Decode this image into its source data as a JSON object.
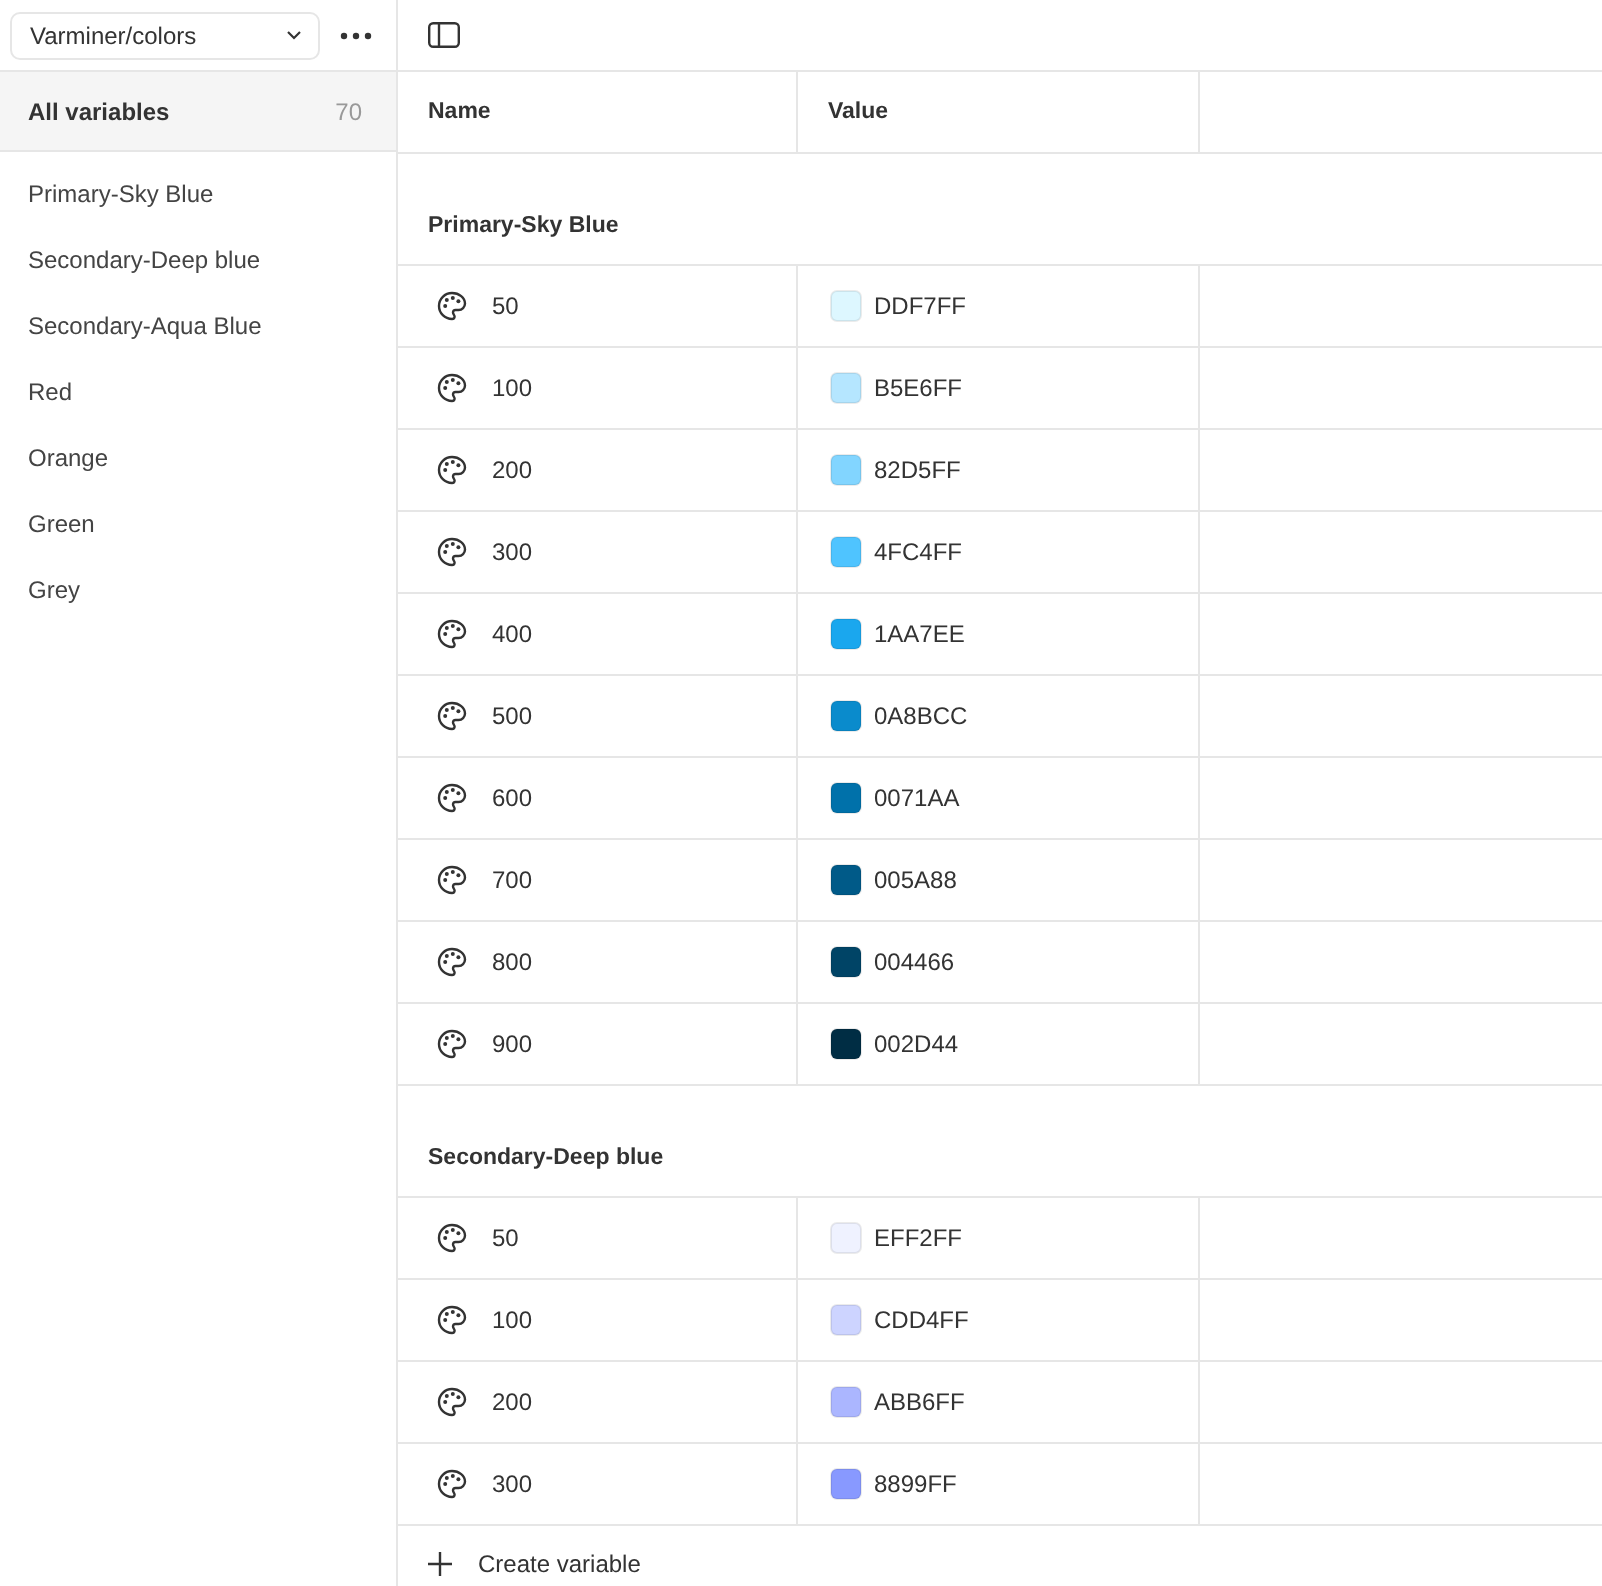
{
  "sidebar": {
    "collection_dropdown": {
      "value": "Varminer/colors"
    },
    "all_variables": {
      "label": "All variables",
      "count": "70",
      "selected": true
    },
    "groups": [
      {
        "label": "Primary-Sky Blue",
        "selected": false
      },
      {
        "label": "Secondary-Deep blue",
        "selected": false
      },
      {
        "label": "Secondary-Aqua Blue",
        "selected": false
      },
      {
        "label": "Red",
        "selected": false
      },
      {
        "label": "Orange",
        "selected": false
      },
      {
        "label": "Green",
        "selected": false
      },
      {
        "label": "Grey",
        "selected": false
      }
    ]
  },
  "table": {
    "columns": [
      "Name",
      "Value"
    ],
    "groups": [
      {
        "title": "Primary-Sky Blue",
        "rows": [
          {
            "name": "50",
            "value": "DDF7FF",
            "color": "#ddf7ff"
          },
          {
            "name": "100",
            "value": "B5E6FF",
            "color": "#b5e6ff"
          },
          {
            "name": "200",
            "value": "82D5FF",
            "color": "#82d5ff"
          },
          {
            "name": "300",
            "value": "4FC4FF",
            "color": "#4fc4ff"
          },
          {
            "name": "400",
            "value": "1AA7EE",
            "color": "#1aa7ee"
          },
          {
            "name": "500",
            "value": "0A8BCC",
            "color": "#0a8bcc"
          },
          {
            "name": "600",
            "value": "0071AA",
            "color": "#0071aa"
          },
          {
            "name": "700",
            "value": "005A88",
            "color": "#005a88"
          },
          {
            "name": "800",
            "value": "004466",
            "color": "#004466"
          },
          {
            "name": "900",
            "value": "002D44",
            "color": "#002d44"
          }
        ]
      },
      {
        "title": "Secondary-Deep blue",
        "rows": [
          {
            "name": "50",
            "value": "EFF2FF",
            "color": "#eff2ff"
          },
          {
            "name": "100",
            "value": "CDD4FF",
            "color": "#cdd4ff"
          },
          {
            "name": "200",
            "value": "ABB6FF",
            "color": "#abb6ff"
          },
          {
            "name": "300",
            "value": "8899FF",
            "color": "#8899ff"
          }
        ]
      }
    ]
  },
  "create_button": {
    "label": "Create variable"
  }
}
